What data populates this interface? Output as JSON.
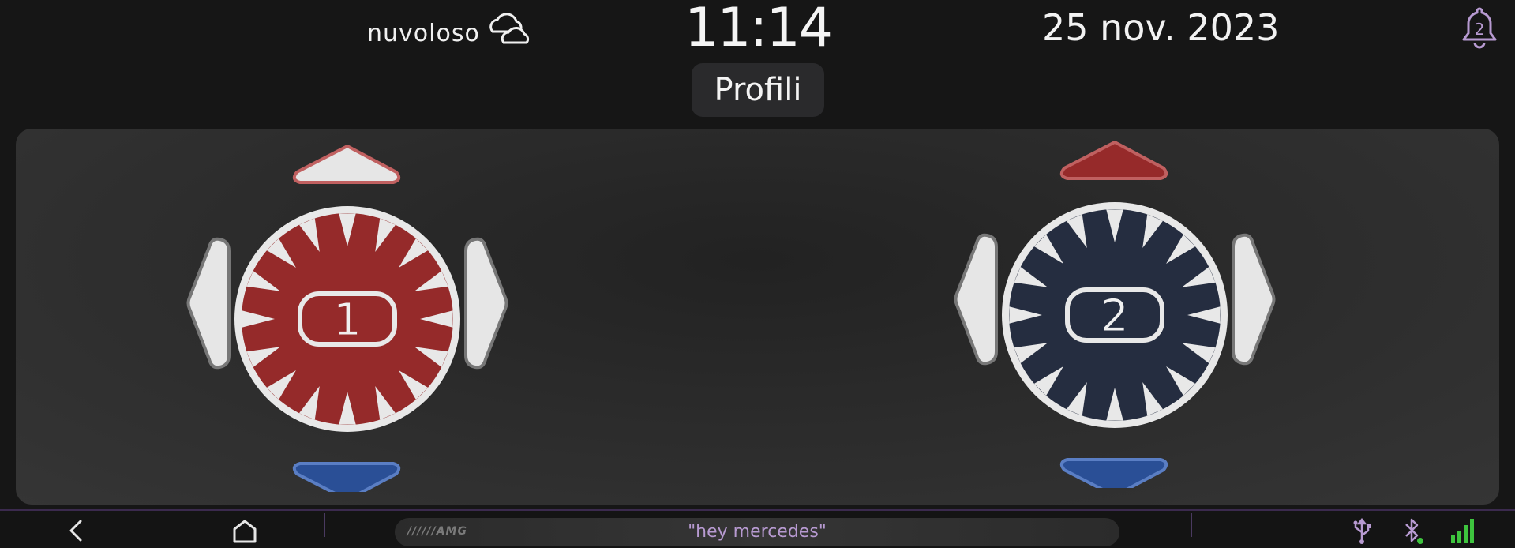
{
  "status_bar": {
    "weather": "nuvoloso",
    "weather_icon": "cloudy-icon",
    "time": "11:14",
    "date": "25 nov. 2023",
    "notifications_count": "2"
  },
  "page_title": "Profili",
  "seats": [
    {
      "profile_number": "1",
      "accent_color": "#952a2a",
      "up_color": "#e6e6e6",
      "down_color": "#2a4f96"
    },
    {
      "profile_number": "2",
      "accent_color": "#252d40",
      "up_color": "#962a2a",
      "down_color": "#2a4f96"
    }
  ],
  "navbar": {
    "back_icon": "back-icon",
    "home_icon": "home-icon",
    "brand": "AMG",
    "voice_hint": "\"hey mercedes\"",
    "usb_icon": "usb-icon",
    "bluetooth_icon": "bluetooth-icon",
    "signal_icon": "signal-icon"
  },
  "colors": {
    "accent_purple": "#b79ad1",
    "background": "#161616"
  }
}
